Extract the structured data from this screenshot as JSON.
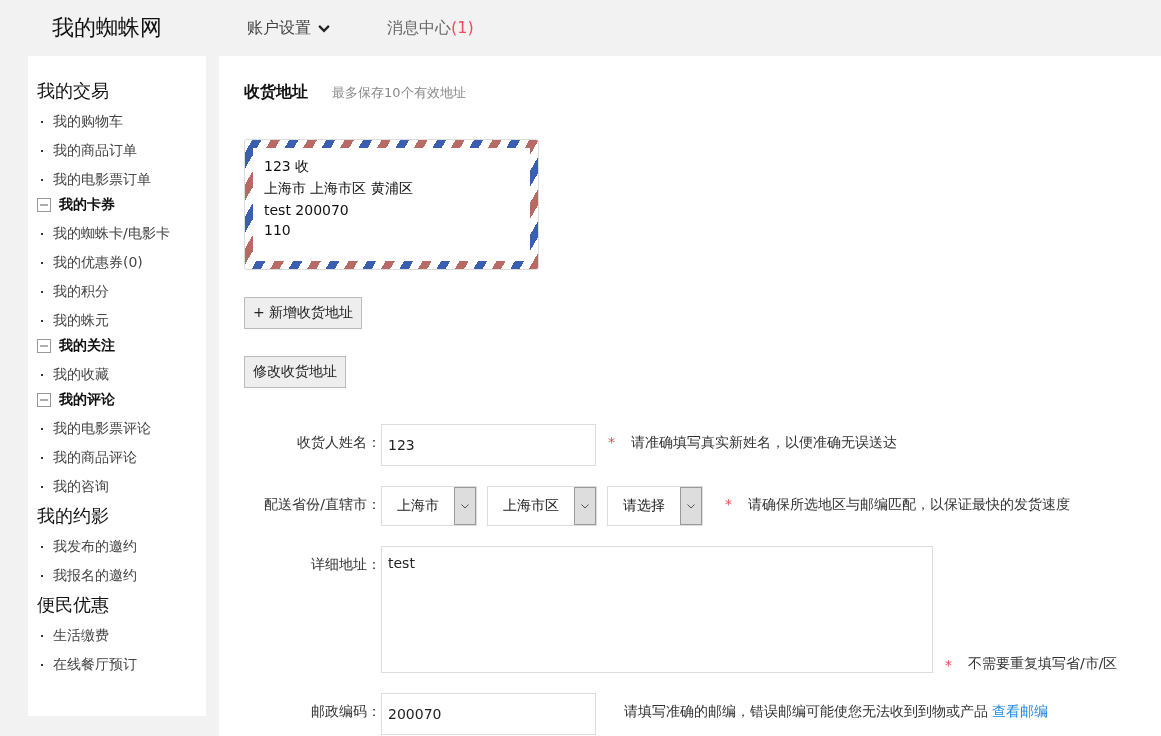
{
  "header": {
    "logo": "我的蜘蛛网",
    "nav": [
      {
        "kind": "dropdown",
        "label": "账户设置"
      },
      {
        "kind": "link",
        "label": "消息中心",
        "count": "(1)"
      }
    ]
  },
  "sidebar": [
    {
      "kind": "heading",
      "title": "我的交易",
      "items": [
        "我的购物车",
        "我的商品订单",
        "我的电影票订单"
      ]
    },
    {
      "kind": "group",
      "title": "我的卡券",
      "expanded": true,
      "items": [
        "我的蜘蛛卡/电影卡",
        "我的优惠券(0)",
        "我的积分",
        "我的蛛元"
      ]
    },
    {
      "kind": "group",
      "title": "我的关注",
      "expanded": true,
      "items": [
        "我的收藏"
      ]
    },
    {
      "kind": "group",
      "title": "我的评论",
      "expanded": true,
      "items": [
        "我的电影票评论",
        "我的商品评论",
        "我的咨询"
      ]
    },
    {
      "kind": "heading",
      "title": "我的约影",
      "items": [
        "我发布的邀约",
        "我报名的邀约"
      ]
    },
    {
      "kind": "heading",
      "title": "便民优惠",
      "items": [
        "生活缴费",
        "在线餐厅预订"
      ]
    }
  ],
  "main": {
    "title": "收货地址",
    "subtitle": "最多保存10个有效地址",
    "address_card": [
      "123 收",
      "上海市 上海市区 黄浦区",
      "test 200070",
      "110"
    ],
    "add_button": "+ 新增收货地址",
    "edit_button": "修改收货地址",
    "form": [
      {
        "kind": "text",
        "label": "收货人姓名：",
        "value": "123",
        "required": "*",
        "hint": "请准确填写真实新姓名，以便准确无误送达"
      },
      {
        "kind": "selects",
        "label": "配送省份/直辖市：",
        "values": [
          "上海市",
          "上海市区",
          "请选择"
        ],
        "required": "*",
        "hint": "请确保所选地区与邮编匹配，以保证最快的发货速度"
      },
      {
        "kind": "textarea",
        "label": "详细地址：",
        "value": "test",
        "required": "*",
        "hint": "不需要重复填写省/市/区"
      },
      {
        "kind": "text",
        "label": "邮政编码：",
        "value": "200070",
        "hint": "请填写准确的邮编，错误邮编可能使您无法收到到物或产品",
        "link": "查看邮编"
      }
    ]
  }
}
